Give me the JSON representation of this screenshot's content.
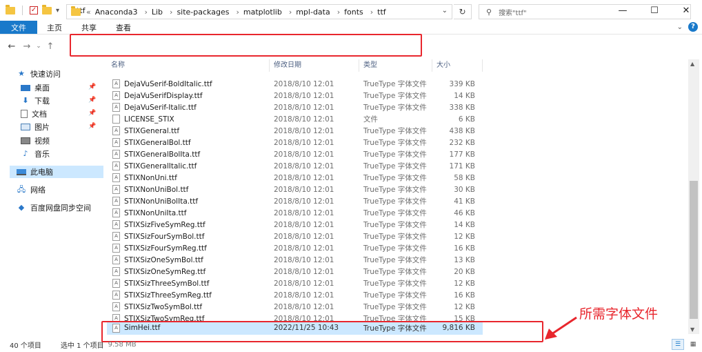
{
  "window": {
    "title": "ttf",
    "controls": {
      "minimize": "—",
      "maximize": "☐",
      "close": "✕"
    }
  },
  "ribbon": {
    "tabs": [
      {
        "label": "文件"
      },
      {
        "label": "主页"
      },
      {
        "label": "共享"
      },
      {
        "label": "查看"
      }
    ],
    "help": "?"
  },
  "address": {
    "breadcrumbs": [
      "Anaconda3",
      "Lib",
      "site-packages",
      "matplotlib",
      "mpl-data",
      "fonts",
      "ttf"
    ],
    "search_placeholder": "搜索\"ttf\""
  },
  "sidebar": {
    "items": [
      {
        "label": "快速访问",
        "icon": "star-icon"
      },
      {
        "label": "桌面",
        "icon": "desktop-icon",
        "pinned": true
      },
      {
        "label": "下载",
        "icon": "download-icon",
        "pinned": true
      },
      {
        "label": "文档",
        "icon": "document-icon",
        "pinned": true
      },
      {
        "label": "图片",
        "icon": "picture-icon",
        "pinned": true
      },
      {
        "label": "视频",
        "icon": "video-icon"
      },
      {
        "label": "音乐",
        "icon": "music-icon"
      },
      {
        "label": "此电脑",
        "icon": "computer-icon",
        "selected": true
      },
      {
        "label": "网络",
        "icon": "network-icon"
      },
      {
        "label": "百度网盘同步空间",
        "icon": "cloud-icon"
      }
    ]
  },
  "columns": {
    "name": "名称",
    "date": "修改日期",
    "type": "类型",
    "size": "大小"
  },
  "files": [
    {
      "name": "DejaVuSerif-BoldItalic.ttf",
      "date": "2018/8/10 12:01",
      "type": "TrueType 字体文件",
      "size": "339 KB"
    },
    {
      "name": "DejaVuSerifDisplay.ttf",
      "date": "2018/8/10 12:01",
      "type": "TrueType 字体文件",
      "size": "14 KB"
    },
    {
      "name": "DejaVuSerif-Italic.ttf",
      "date": "2018/8/10 12:01",
      "type": "TrueType 字体文件",
      "size": "338 KB"
    },
    {
      "name": "LICENSE_STIX",
      "date": "2018/8/10 12:01",
      "type": "文件",
      "size": "6 KB",
      "plain": true
    },
    {
      "name": "STIXGeneral.ttf",
      "date": "2018/8/10 12:01",
      "type": "TrueType 字体文件",
      "size": "438 KB"
    },
    {
      "name": "STIXGeneralBol.ttf",
      "date": "2018/8/10 12:01",
      "type": "TrueType 字体文件",
      "size": "232 KB"
    },
    {
      "name": "STIXGeneralBolIta.ttf",
      "date": "2018/8/10 12:01",
      "type": "TrueType 字体文件",
      "size": "177 KB"
    },
    {
      "name": "STIXGeneralItalic.ttf",
      "date": "2018/8/10 12:01",
      "type": "TrueType 字体文件",
      "size": "171 KB"
    },
    {
      "name": "STIXNonUni.ttf",
      "date": "2018/8/10 12:01",
      "type": "TrueType 字体文件",
      "size": "58 KB"
    },
    {
      "name": "STIXNonUniBol.ttf",
      "date": "2018/8/10 12:01",
      "type": "TrueType 字体文件",
      "size": "30 KB"
    },
    {
      "name": "STIXNonUniBolIta.ttf",
      "date": "2018/8/10 12:01",
      "type": "TrueType 字体文件",
      "size": "41 KB"
    },
    {
      "name": "STIXNonUniIta.ttf",
      "date": "2018/8/10 12:01",
      "type": "TrueType 字体文件",
      "size": "46 KB"
    },
    {
      "name": "STIXSizFiveSymReg.ttf",
      "date": "2018/8/10 12:01",
      "type": "TrueType 字体文件",
      "size": "14 KB"
    },
    {
      "name": "STIXSizFourSymBol.ttf",
      "date": "2018/8/10 12:01",
      "type": "TrueType 字体文件",
      "size": "12 KB"
    },
    {
      "name": "STIXSizFourSymReg.ttf",
      "date": "2018/8/10 12:01",
      "type": "TrueType 字体文件",
      "size": "16 KB"
    },
    {
      "name": "STIXSizOneSymBol.ttf",
      "date": "2018/8/10 12:01",
      "type": "TrueType 字体文件",
      "size": "13 KB"
    },
    {
      "name": "STIXSizOneSymReg.ttf",
      "date": "2018/8/10 12:01",
      "type": "TrueType 字体文件",
      "size": "20 KB"
    },
    {
      "name": "STIXSizThreeSymBol.ttf",
      "date": "2018/8/10 12:01",
      "type": "TrueType 字体文件",
      "size": "12 KB"
    },
    {
      "name": "STIXSizThreeSymReg.ttf",
      "date": "2018/8/10 12:01",
      "type": "TrueType 字体文件",
      "size": "16 KB"
    },
    {
      "name": "STIXSizTwoSymBol.ttf",
      "date": "2018/8/10 12:01",
      "type": "TrueType 字体文件",
      "size": "12 KB"
    },
    {
      "name": "STIXSizTwoSymReg.ttf",
      "date": "2018/8/10 12:01",
      "type": "TrueType 字体文件",
      "size": "15 KB"
    },
    {
      "name": "SimHei.ttf",
      "date": "2022/11/25 10:43",
      "type": "TrueType 字体文件",
      "size": "9,816 KB",
      "selected": true
    }
  ],
  "status": {
    "count": "40 个项目",
    "selected": "选中 1 个项目",
    "selected_size": "9.58 MB"
  },
  "annotation": {
    "text": "所需字体文件",
    "color": "#e8262d"
  },
  "colors": {
    "accent": "#1979ca",
    "selection": "#cce8ff",
    "highlight": "#e8262d"
  }
}
